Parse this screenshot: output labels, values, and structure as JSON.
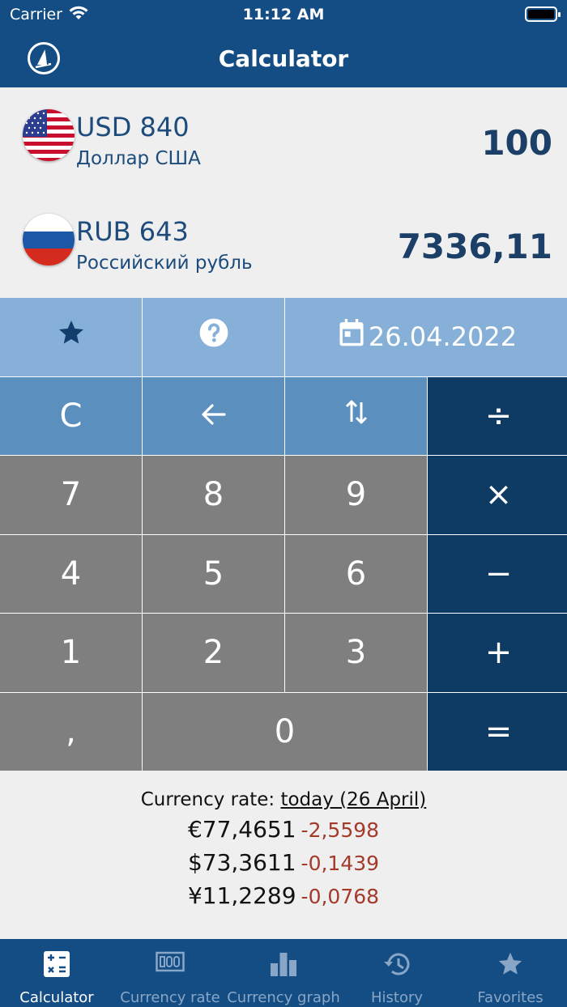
{
  "status_bar": {
    "carrier": "Carrier",
    "time": "11:12 AM"
  },
  "nav": {
    "title": "Calculator"
  },
  "from_currency": {
    "code": "USD 840",
    "name": "Доллар США",
    "value": "100"
  },
  "to_currency": {
    "code": "RUB 643",
    "name": "Российский рубль",
    "value": "7336,11"
  },
  "keypad": {
    "date": "26.04.2022",
    "clear": "C",
    "digits": [
      "7",
      "8",
      "9",
      "4",
      "5",
      "6",
      "1",
      "2",
      "3"
    ],
    "comma": ",",
    "zero": "0",
    "divide": "÷",
    "multiply": "×",
    "minus": "−",
    "plus": "+",
    "equals": "="
  },
  "rates": {
    "label": "Currency rate:",
    "link": "today (26 April)",
    "items": [
      {
        "value": "€77,4651",
        "delta": "-2,5598"
      },
      {
        "value": "$73,3611",
        "delta": "-0,1439"
      },
      {
        "value": "¥11,2289",
        "delta": "-0,0768"
      }
    ]
  },
  "tabs": [
    {
      "label": "Calculator",
      "icon": "calculator-icon"
    },
    {
      "label": "Currency rate",
      "icon": "banknote-icon"
    },
    {
      "label": "Currency graph",
      "icon": "bar-chart-icon"
    },
    {
      "label": "History",
      "icon": "history-icon"
    },
    {
      "label": "Favorites",
      "icon": "star-icon"
    }
  ],
  "colors": {
    "nav": "#134d84",
    "key_top": "#86b0d8",
    "key_func": "#5b8fbe",
    "key_num": "#7f7f7f",
    "key_op": "#0e3b64",
    "delta": "#a33a2c"
  }
}
